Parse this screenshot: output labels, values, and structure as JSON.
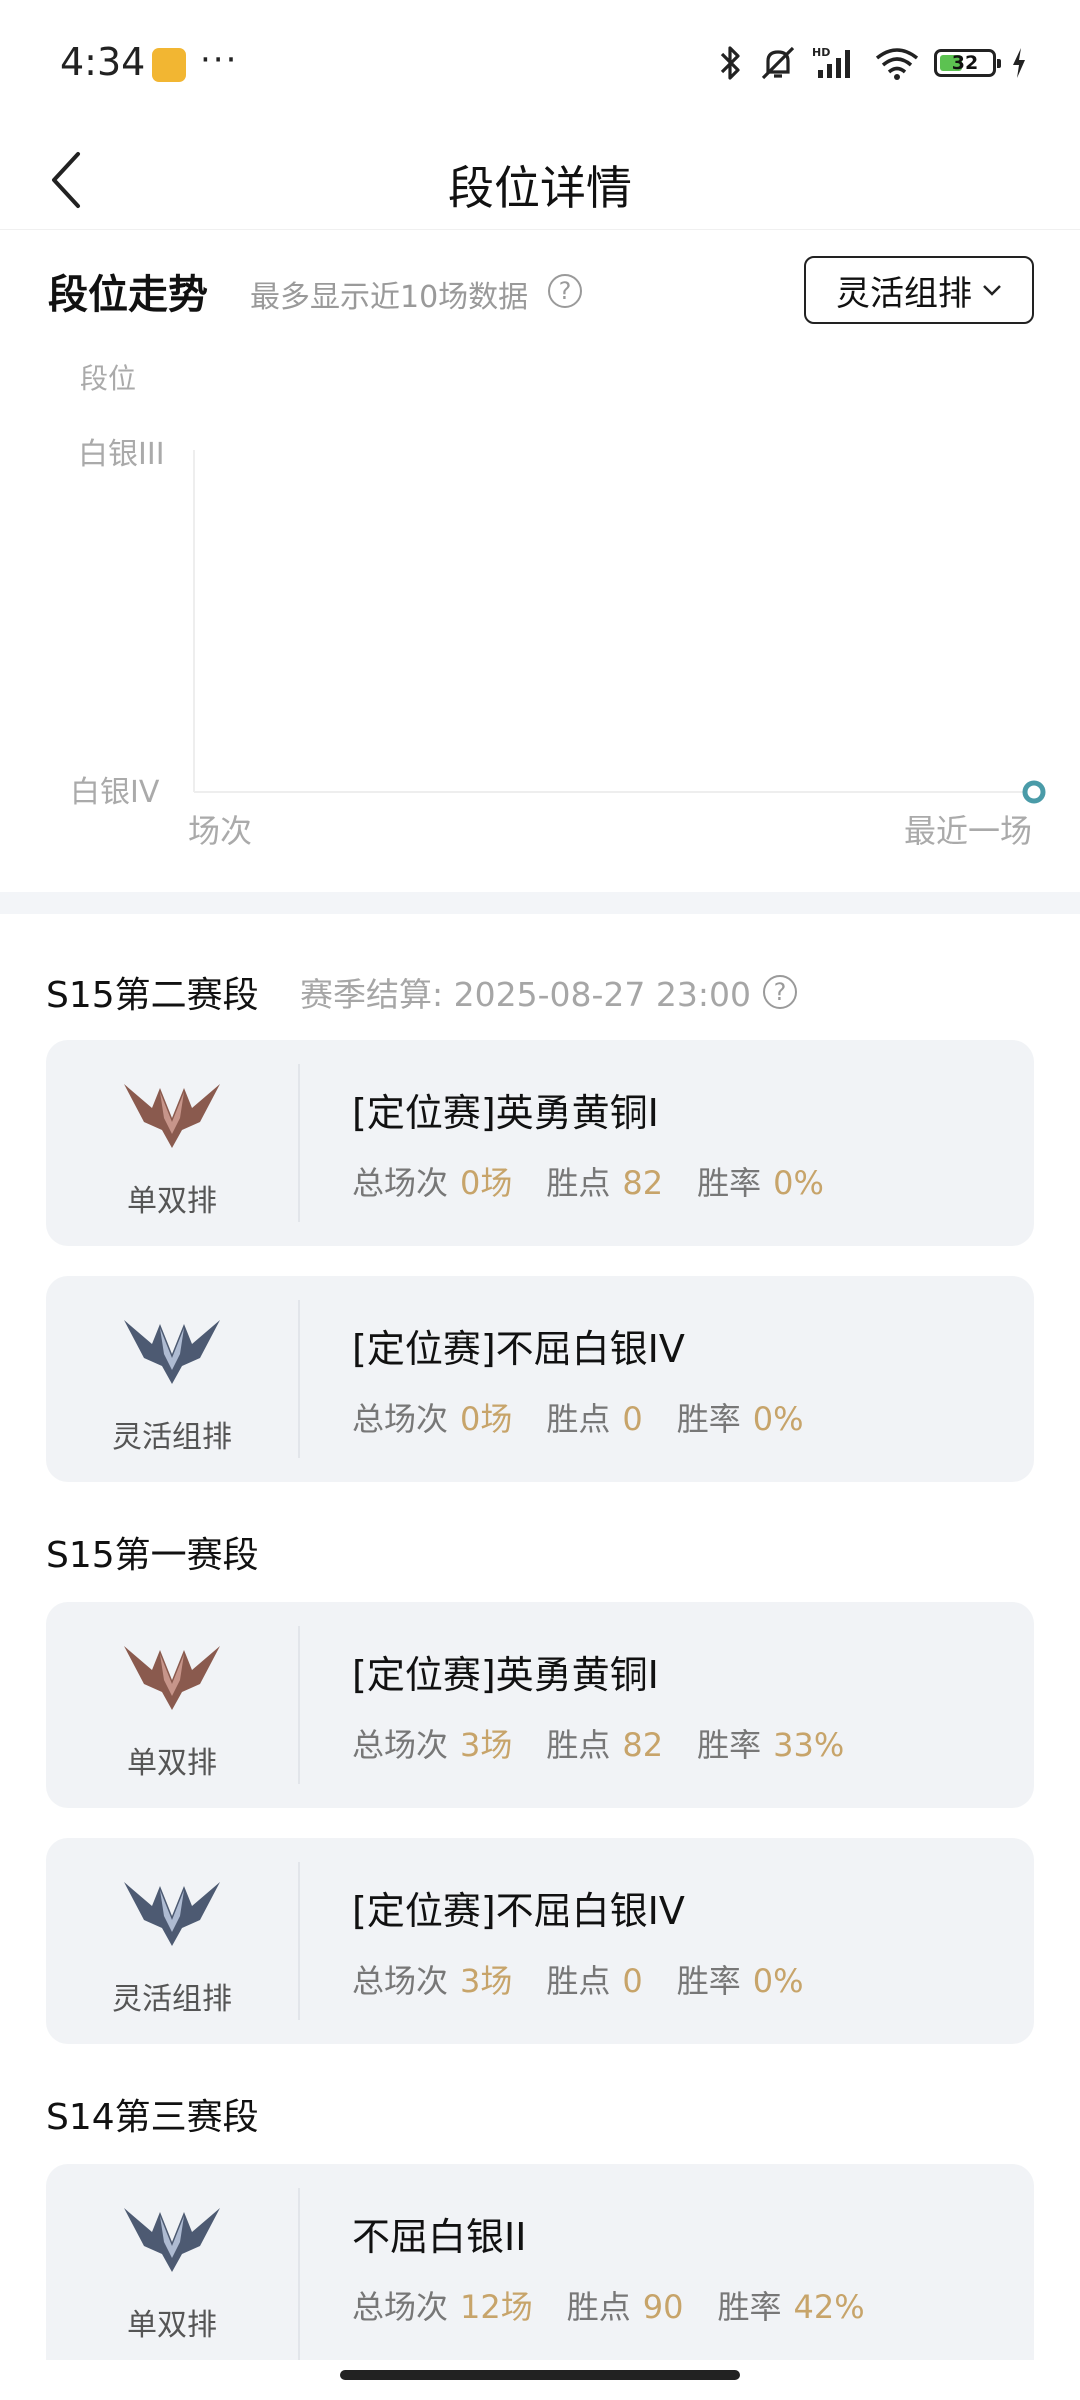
{
  "status_bar": {
    "time": "4:34",
    "more": "···",
    "battery": "32"
  },
  "header": {
    "title": "段位详情"
  },
  "trend": {
    "title": "段位走势",
    "subtitle": "最多显示近10场数据",
    "mode_select": "灵活组排",
    "chart_data": {
      "type": "line",
      "ylabel": "段位",
      "y_ticks": [
        "白银III",
        "白银IV"
      ],
      "x_ticks": [
        "场次",
        "最近一场"
      ],
      "points": [
        {
          "x": "最近一场",
          "y": "白银IV"
        }
      ]
    }
  },
  "seasons": [
    {
      "name": "S15第二赛段",
      "meta": "赛季结算: 2025-08-27 23:00",
      "cards": [
        {
          "queue": "单双排",
          "emblem": "bronze",
          "rank": "[定位赛]英勇黄铜I",
          "games_label": "总场次",
          "games": "0场",
          "points_label": "胜点",
          "points": "82",
          "winrate_label": "胜率",
          "winrate": "0%"
        },
        {
          "queue": "灵活组排",
          "emblem": "silver",
          "rank": "[定位赛]不屈白银IV",
          "games_label": "总场次",
          "games": "0场",
          "points_label": "胜点",
          "points": "0",
          "winrate_label": "胜率",
          "winrate": "0%"
        }
      ]
    },
    {
      "name": "S15第一赛段",
      "cards": [
        {
          "queue": "单双排",
          "emblem": "bronze",
          "rank": "[定位赛]英勇黄铜I",
          "games_label": "总场次",
          "games": "3场",
          "points_label": "胜点",
          "points": "82",
          "winrate_label": "胜率",
          "winrate": "33%"
        },
        {
          "queue": "灵活组排",
          "emblem": "silver",
          "rank": "[定位赛]不屈白银IV",
          "games_label": "总场次",
          "games": "3场",
          "points_label": "胜点",
          "points": "0",
          "winrate_label": "胜率",
          "winrate": "0%"
        }
      ]
    },
    {
      "name": "S14第三赛段",
      "cards": [
        {
          "queue": "单双排",
          "emblem": "silver",
          "rank": "不屈白银II",
          "games_label": "总场次",
          "games": "12场",
          "points_label": "胜点",
          "points": "90",
          "winrate_label": "胜率",
          "winrate": "42%"
        }
      ]
    }
  ],
  "colors": {
    "accent_value": "#c7a46a",
    "card_bg": "#f1f3f6",
    "chart_point": "#4a9ba8"
  }
}
